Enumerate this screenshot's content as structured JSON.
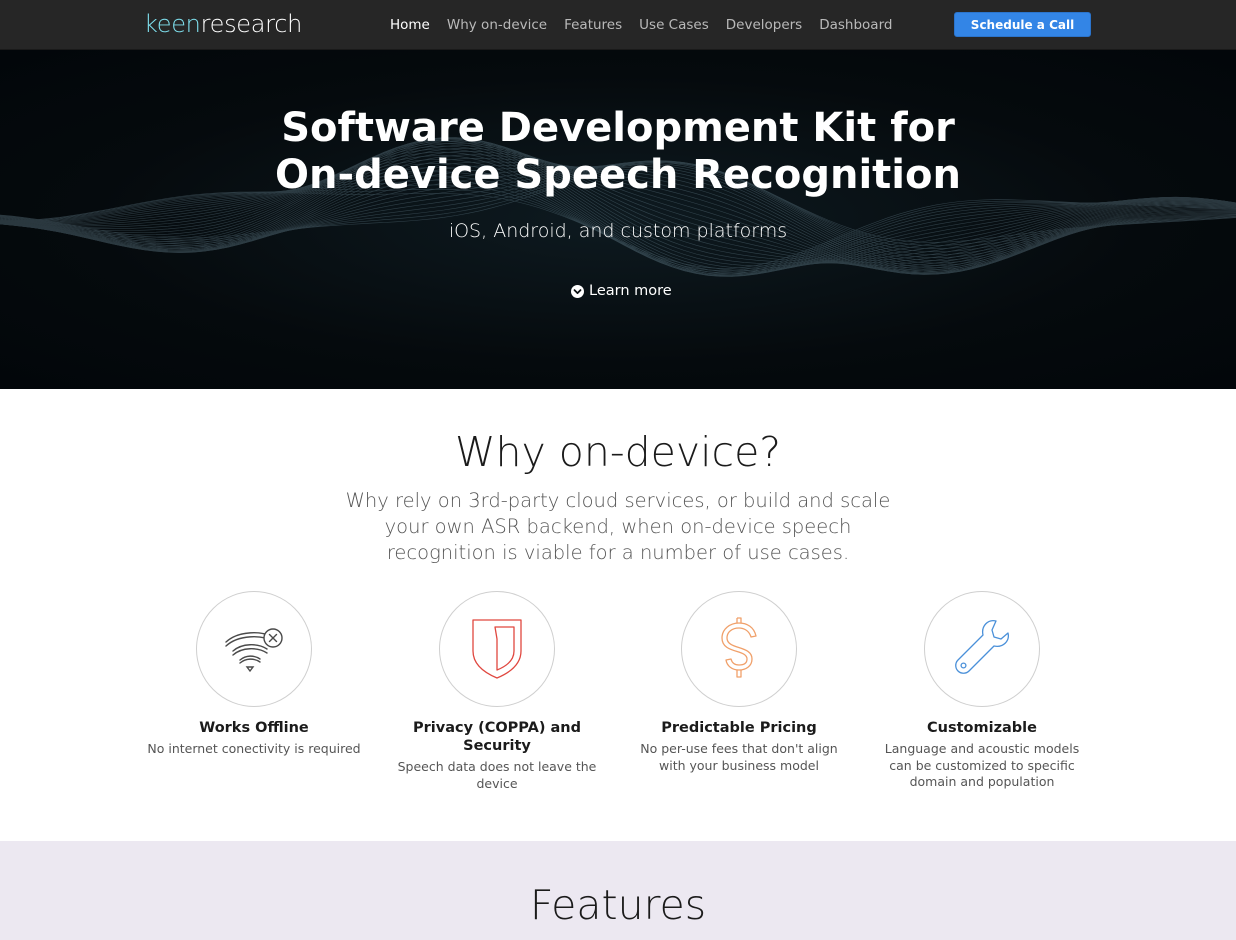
{
  "brand": {
    "part1": "keen",
    "part2": "research"
  },
  "nav": {
    "items": [
      {
        "label": "Home",
        "active": true
      },
      {
        "label": "Why on-device",
        "active": false
      },
      {
        "label": "Features",
        "active": false
      },
      {
        "label": "Use Cases",
        "active": false
      },
      {
        "label": "Developers",
        "active": false
      },
      {
        "label": "Dashboard",
        "active": false
      }
    ],
    "cta_label": "Schedule a Call"
  },
  "hero": {
    "title_line1": "Software Development Kit for",
    "title_line2": "On-device Speech Recognition",
    "subtitle": "iOS, Android, and custom platforms",
    "learn_more": "Learn more"
  },
  "why": {
    "title": "Why on-device?",
    "lead": "Why rely on 3rd-party cloud services, or build and scale your own ASR backend, when on-device speech recognition is viable for a number of use cases.",
    "items": [
      {
        "icon": "wifi-off-icon",
        "title": "Works Offline",
        "desc": "No internet conectivity is required"
      },
      {
        "icon": "shield-icon",
        "title": "Privacy (COPPA) and Security",
        "desc": "Speech data does not leave the device"
      },
      {
        "icon": "dollar-icon",
        "title": "Predictable Pricing",
        "desc": "No per-use fees that don't align with your business model"
      },
      {
        "icon": "wrench-icon",
        "title": "Customizable",
        "desc": "Language and acoustic models can be customized to specific domain and population"
      }
    ]
  },
  "features": {
    "title": "Features"
  },
  "colors": {
    "nav_bg": "#262626",
    "accent": "#3385e6",
    "brand_keen": "#7fe0ee",
    "shield": "#e0473f",
    "dollar": "#f0a06a",
    "wrench": "#4a90d9",
    "features_bg": "#ece8f1"
  }
}
